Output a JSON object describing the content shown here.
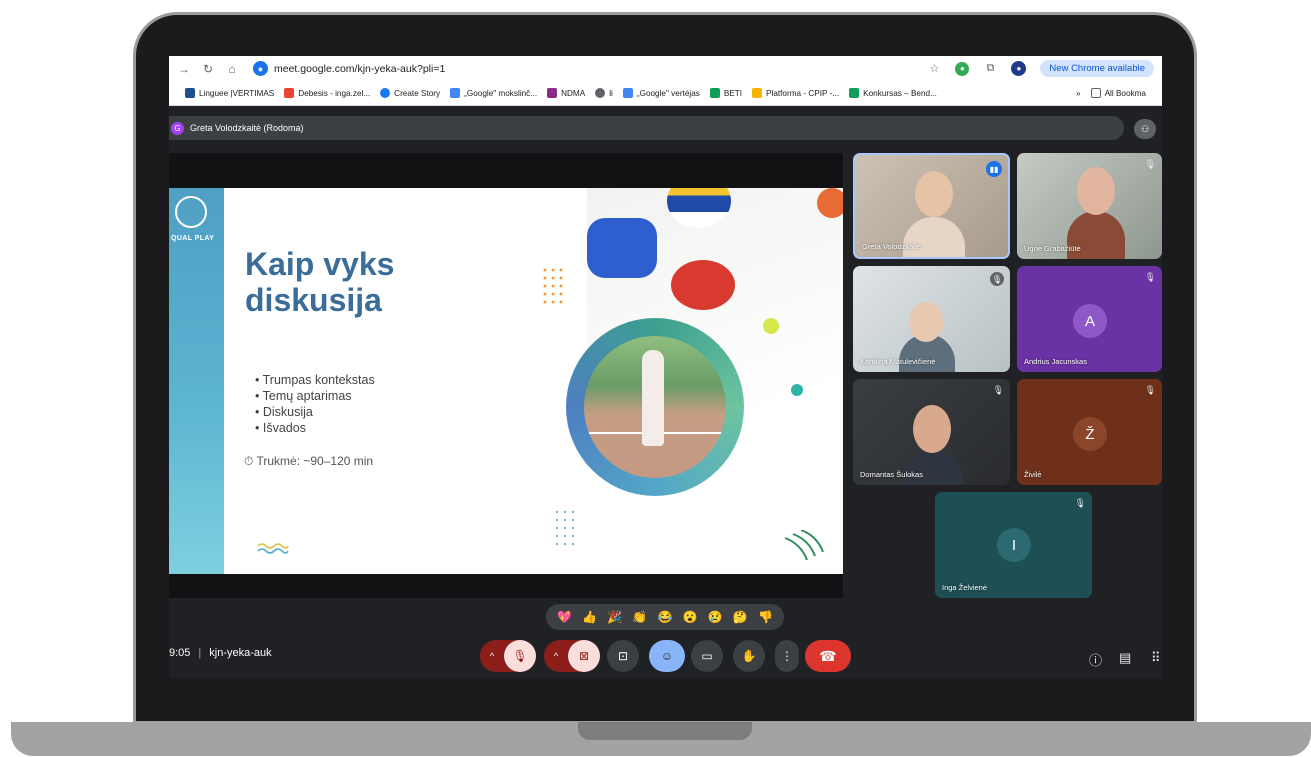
{
  "browser": {
    "url": "meet.google.com/kjn-yeka-auk?pli=1",
    "update_chip": "New Chrome available",
    "bookmarks": [
      "Linguee |VERTIMAS",
      "Debesis - inga.zel...",
      "Create Story",
      "„Google\" mokslinč...",
      "NDMA",
      "li",
      "„Google\" vertėjas",
      "BETI",
      "Platforma - CPIP -...",
      "Konkursas – Bend..."
    ],
    "bookmarks_more": "»",
    "all_bookmarks": "All Bookma"
  },
  "meet": {
    "presenter_initial": "G",
    "presenter_label": "Greta Volodzkaitė (Rodoma)",
    "time": "9:05",
    "separator": "|",
    "meeting_code": "kjn-yeka-auk"
  },
  "slide": {
    "logo_text": "QUAL PLAY",
    "title": "Kaip vyks diskusija",
    "bullets": [
      "Trumpas kontekstas",
      "Temų aptarimas",
      "Diskusija",
      "Išvados"
    ],
    "duration": "⏱ Trukmė: ~90–120 min"
  },
  "participants": [
    {
      "name": "Greta Volodzkaitė",
      "state": "speaking"
    },
    {
      "name": "Ugnė Grabažiūtė",
      "state": "muted"
    },
    {
      "name": "Karolina Matulevičienė",
      "state": "muted"
    },
    {
      "name": "Andrius Jacunskas",
      "state": "muted",
      "initial": "A"
    },
    {
      "name": "Domantas Šulokas",
      "state": "muted"
    },
    {
      "name": "Živilė",
      "state": "muted",
      "initial": "Ž"
    },
    {
      "name": "Inga Želvienė",
      "state": "muted",
      "initial": "I"
    }
  ],
  "reactions": [
    "💖",
    "👍",
    "🎉",
    "👏",
    "😂",
    "😮",
    "😢",
    "🤔",
    "👎"
  ],
  "controls": {
    "chevron": "^"
  },
  "colors": {
    "meet_bg": "#202124",
    "end_call": "#dc362e",
    "muted_red": "#8c1d18",
    "slide_title": "#3a6d99",
    "slide_strip": "#5bb4d1"
  }
}
